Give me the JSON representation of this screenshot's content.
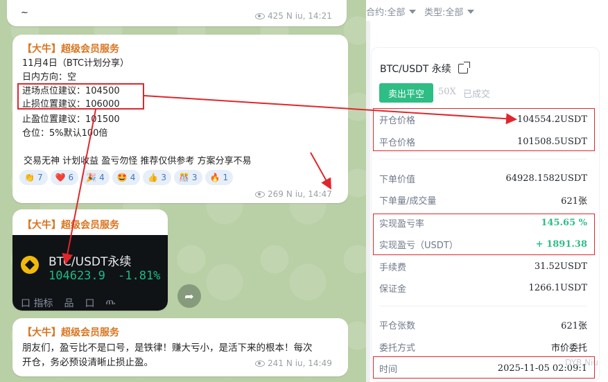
{
  "chat": {
    "top_message": {
      "text": "~",
      "views": "425",
      "time": "N iu, 14:21"
    },
    "main_message": {
      "sender": "【大牛】超级会员服务",
      "lines": [
        "11月4日（BTC计划分享）",
        "日内方向：空",
        "进场点位建议：104500",
        "止损位置建议：106000",
        "止盈位置建议：101500",
        "仓位：5%默认100倍"
      ],
      "disclaimer": "交易无神 计划收益 盈亏勿怪 推荐仅供参考 方案分享不易",
      "reactions": [
        {
          "emoji": "👏",
          "count": "7"
        },
        {
          "emoji": "❤️",
          "count": "6"
        },
        {
          "emoji": "🎉",
          "count": "4"
        },
        {
          "emoji": "🤩",
          "count": "4"
        },
        {
          "emoji": "👍",
          "count": "3"
        },
        {
          "emoji": "🎊",
          "count": "3"
        },
        {
          "emoji": "🔥",
          "count": "1"
        }
      ],
      "views": "269",
      "time": "N iu, 14:47"
    },
    "card_message": {
      "sender": "【大牛】超级会员服务",
      "pair": "BTC/USDT永续",
      "price": "104623.9",
      "change": "-1.81%",
      "strip": [
        "口 指标",
        "品",
        "口",
        "ጤ"
      ]
    },
    "last_message": {
      "sender": "【大牛】超级会员服务",
      "line1": "朋友们，盈亏比不是口号，是铁律！赚大亏小，是活下来的根本！每次",
      "line2": "开仓，务必预设清晰止损止盈。",
      "views": "241",
      "time": "N iu, 14:49"
    }
  },
  "filters": {
    "contract": "合约:全部",
    "type": "类型:全部"
  },
  "order": {
    "title": "BTC/USDT 永续",
    "action_label": "卖出平空",
    "leverage": "50X",
    "status": "已成交",
    "rows": [
      {
        "k": "开仓价格",
        "v": "104554.2USDT"
      },
      {
        "k": "平仓价格",
        "v": "101508.5USDT"
      },
      {
        "k": "下单价值",
        "v": "64928.1582USDT"
      },
      {
        "k": "下单量/成交量",
        "v": "621张"
      },
      {
        "k": "实现盈亏率",
        "v": "145.65 %"
      },
      {
        "k": "实现盈亏（USDT）",
        "v": "+ 1891.38"
      },
      {
        "k": "手续费",
        "v": "31.52USDT"
      },
      {
        "k": "保证金",
        "v": "1266.1USDT"
      },
      {
        "k": "平仓张数",
        "v": "621张"
      },
      {
        "k": "委托方式",
        "v": "市价委托"
      },
      {
        "k": "时间",
        "v": "2025-11-05 02:09:1"
      }
    ],
    "watermark": "DYB Niu"
  },
  "colors": {
    "accent_green": "#2ebd85",
    "annotation_red": "#e0262b",
    "sender_orange": "#d9741f"
  }
}
